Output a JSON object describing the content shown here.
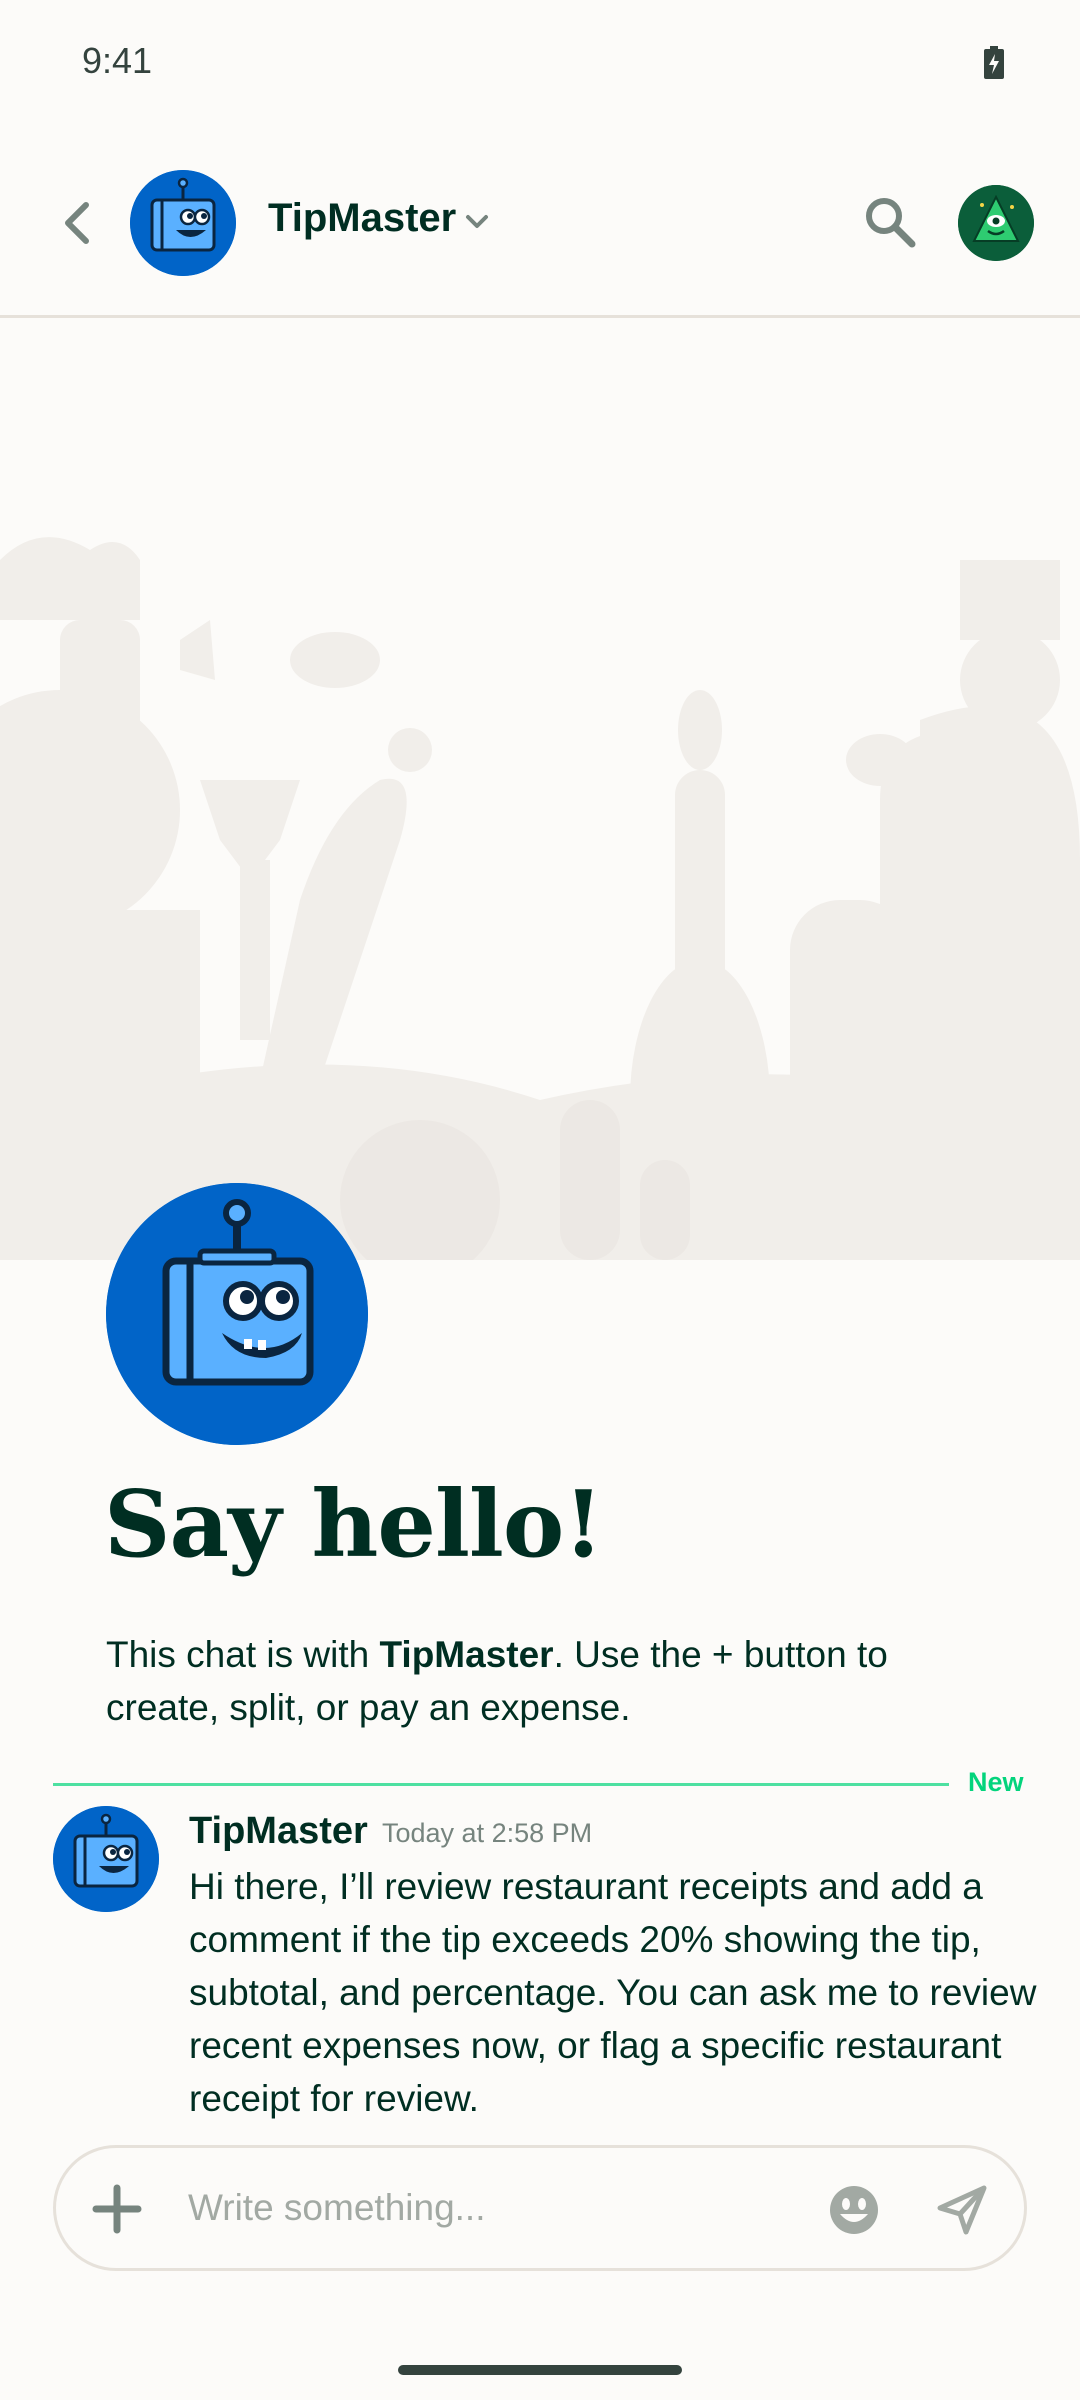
{
  "status_bar": {
    "time": "9:41"
  },
  "header": {
    "title": "TipMaster"
  },
  "welcome": {
    "heading": "Say hello!",
    "text_prefix": "This chat is with ",
    "text_name": "TipMaster",
    "text_suffix": ". Use the + button to create, split, or pay an expense."
  },
  "divider": {
    "label": "New"
  },
  "message": {
    "author": "TipMaster",
    "time": "Today at 2:58 PM",
    "body": "Hi there, I’ll review restaurant receipts and add a comment if the tip exceeds 20% showing the tip, subtotal, and percentage. You can ask me to review recent expenses now, or flag a specific restaurant receipt for review."
  },
  "composer": {
    "placeholder": "Write something..."
  },
  "colors": {
    "accent": "#03D47C",
    "text": "#002E22",
    "robot_blue": "#0164C8"
  },
  "icons": [
    "battery-icon",
    "back-icon",
    "chevron-down-icon",
    "search-icon",
    "plus-icon",
    "emoji-icon",
    "send-icon"
  ]
}
